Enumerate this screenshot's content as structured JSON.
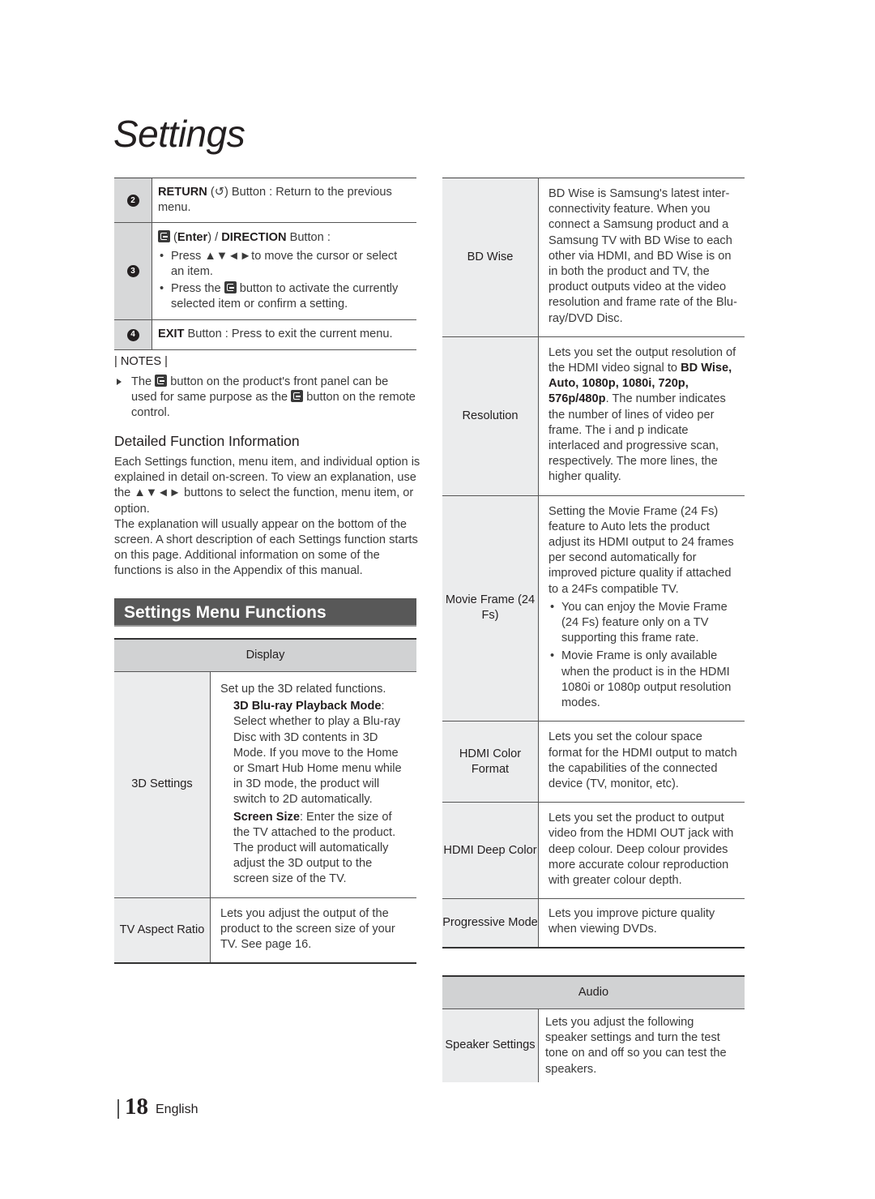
{
  "page_title": "Settings",
  "remote_buttons": [
    {
      "num": "2",
      "name_bold": "RETURN",
      "icon": "return-icon",
      "rest": " Button : Return to the previous menu."
    },
    {
      "num": "3",
      "title_bold1": "Enter",
      "title_sep": ") / ",
      "title_bold2": "DIRECTION",
      "title_rest": " Button :",
      "bullets": [
        "Press ▲▼◄►to move the cursor or select an item.",
        "button to activate the currently selected item or confirm a setting."
      ],
      "bullet2_prefix": "Press the"
    },
    {
      "num": "4",
      "name_bold": "EXIT",
      "rest": " Button : Press to exit the current menu."
    }
  ],
  "notes": {
    "heading": "| NOTES |",
    "text_a": "The",
    "text_b": "button on the product's front panel can be used for same purpose as the",
    "text_c": "button on the remote control."
  },
  "detailed": {
    "heading": "Detailed Function Information",
    "p1": "Each Settings function, menu item, and individual option is explained in detail on-screen. To view an explanation, use the ▲▼◄► buttons to select the function, menu item, or option.",
    "p2": "The explanation will usually appear on the bottom of the screen. A short description of each Settings function starts on this page. Additional information on some of the functions is also in the Appendix of this manual."
  },
  "banner": "Settings Menu Functions",
  "display_table": {
    "section": "Display",
    "rows": [
      {
        "label": "3D Settings",
        "intro": "Set up the 3D related functions.",
        "item1_bold": "3D Blu-ray Playback Mode",
        "item1_rest": ": Select whether to play a Blu-ray Disc with 3D contents in 3D Mode. If you move to the Home or Smart Hub Home menu while in 3D mode, the product will switch to 2D automatically.",
        "item2_bold": "Screen Size",
        "item2_rest": ": Enter the size of the TV attached to the product. The product will automatically adjust the 3D output to the screen size of the TV."
      },
      {
        "label": "TV Aspect Ratio",
        "desc": "Lets you adjust the output of the product to the screen size of your TV. See page 16."
      }
    ]
  },
  "right_table": {
    "rows": [
      {
        "label": "BD Wise",
        "desc": "BD Wise is Samsung's latest inter-connectivity feature. When you connect a Samsung product and a Samsung TV with BD Wise to each other via HDMI, and BD Wise is on in both the product and TV, the product outputs video at the video resolution and frame rate of the Blu-ray/DVD Disc."
      },
      {
        "label": "Resolution",
        "desc_a": "Lets you set the output resolution of the HDMI video signal to",
        "desc_bold": "BD Wise, Auto, 1080p, 1080i, 720p, 576p/480p",
        "desc_b": ". The number indicates the number of lines of video per frame. The i and p indicate interlaced and progressive scan, respectively. The more lines, the higher quality."
      },
      {
        "label": "Movie Frame (24 Fs)",
        "desc": "Setting the Movie Frame (24 Fs) feature to Auto lets the product adjust its HDMI output to 24 frames per second automatically for improved picture quality if attached to a 24Fs compatible TV.",
        "bullets": [
          "You can enjoy the Movie Frame (24 Fs) feature only on a TV supporting this frame rate.",
          "Movie Frame is only available when the product is in the HDMI 1080i or 1080p output resolution modes."
        ]
      },
      {
        "label": "HDMI Color Format",
        "desc": "Lets you set the colour space format for the HDMI output to match the capabilities of the connected device (TV, monitor, etc)."
      },
      {
        "label": "HDMI Deep Color",
        "desc": "Lets you set the product to output video from the HDMI OUT jack with deep colour. Deep colour provides more accurate colour reproduction with greater colour depth."
      },
      {
        "label": "Progressive Mode",
        "desc": "Lets you improve picture quality when viewing DVDs."
      }
    ]
  },
  "audio_table": {
    "section": "Audio",
    "rows": [
      {
        "label": "Speaker Settings",
        "desc": "Lets you adjust the following speaker settings and turn the test tone on and off so you can test the speakers."
      }
    ]
  },
  "footer": {
    "page_number": "18",
    "language": "English"
  }
}
